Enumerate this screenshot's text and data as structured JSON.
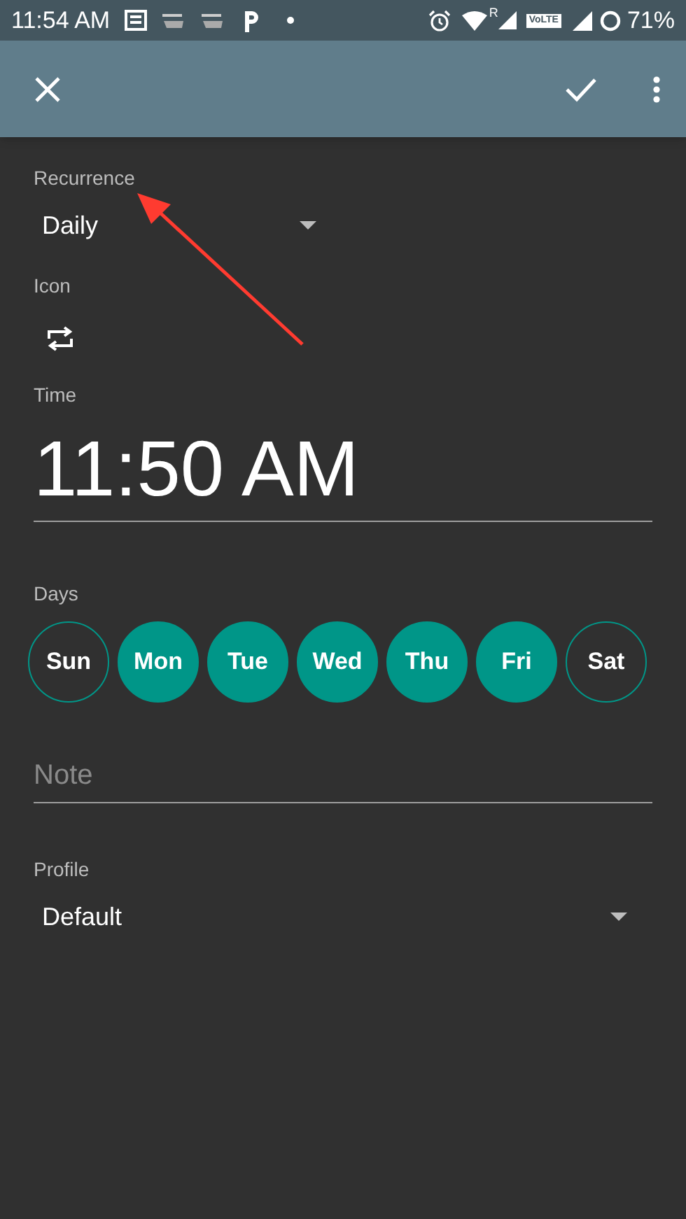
{
  "status_bar": {
    "time": "11:54 AM",
    "roaming": "R",
    "volte": "VoLTE",
    "battery": "71%"
  },
  "recurrence": {
    "label": "Recurrence",
    "value": "Daily"
  },
  "icon": {
    "label": "Icon"
  },
  "time": {
    "label": "Time",
    "value": "11:50 AM"
  },
  "days": {
    "label": "Days",
    "items": [
      {
        "label": "Sun",
        "selected": false
      },
      {
        "label": "Mon",
        "selected": true
      },
      {
        "label": "Tue",
        "selected": true
      },
      {
        "label": "Wed",
        "selected": true
      },
      {
        "label": "Thu",
        "selected": true
      },
      {
        "label": "Fri",
        "selected": true
      },
      {
        "label": "Sat",
        "selected": false
      }
    ]
  },
  "note": {
    "placeholder": "Note"
  },
  "profile": {
    "label": "Profile",
    "value": "Default"
  }
}
